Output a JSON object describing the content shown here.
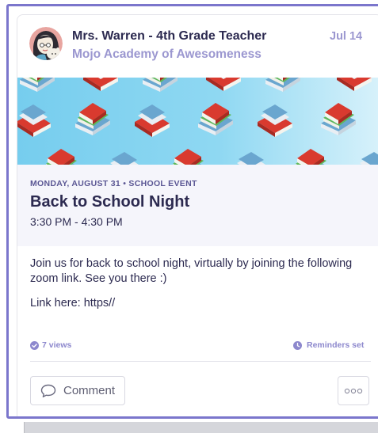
{
  "post": {
    "author": "Mrs. Warren - 4th Grade Teacher",
    "school": "Mojo Academy of Awesomeness",
    "date": "Jul 14",
    "avatar_icon": "teacher-avatar-icon",
    "banner_pattern_icon": "books-icon"
  },
  "event": {
    "kicker": "MONDAY, AUGUST 31 • SCHOOL EVENT",
    "title": "Back to School Night",
    "time": "3:30 PM - 4:30 PM"
  },
  "body": {
    "paragraph_1": "Join us for back to school night, virtually by joining the following zoom link. See you there :)",
    "paragraph_2": "Link here: https//"
  },
  "stats": {
    "views": "7 views",
    "views_icon": "check-circle-icon",
    "reminders": "Reminders set",
    "reminders_icon": "clock-icon"
  },
  "actions": {
    "comment_label": "Comment",
    "comment_icon": "speech-bubble-icon",
    "more_icon": "more-options-icon"
  },
  "colors": {
    "frame": "#7b76cc",
    "title_text": "#2c2a50",
    "muted_purple": "#9b97d0",
    "banner_sky": "#7fd3ef",
    "book_red": "#d93a2f",
    "book_green": "#5fb85c"
  }
}
